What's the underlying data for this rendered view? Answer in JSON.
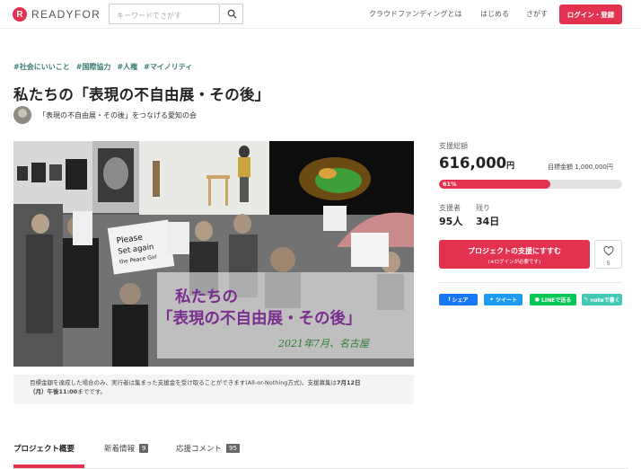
{
  "header": {
    "logo_mark": "R",
    "logo_text": "READYFOR",
    "search_placeholder": "キーワードでさがす",
    "nav": [
      "クラウドファンディングとは",
      "はじめる",
      "さがす"
    ],
    "login_label": "ログイン・登録"
  },
  "project": {
    "tags": [
      "#社会にいいこと",
      "#国際協力",
      "#人権",
      "#マイノリティ"
    ],
    "title": "私たちの「表現の不自由展・その後」",
    "owner_name": "「表現の不自由展・その後」をつなげる愛知の会"
  },
  "hero": {
    "line1": "私たちの",
    "line2": "「表現の不自由展・その後」",
    "line3": "2021年7月、名古屋",
    "sign1": "Please",
    "sign2": "Set again",
    "sign3": "the Peace Girl"
  },
  "notice": {
    "text_before": "目標金額を達成した場合のみ、実行者は集まった支援金を受け取ることができます(All-or-Nothing方式)。支援募集は",
    "deadline_a": "7月12日",
    "deadline_b": "（月）午後11:00",
    "text_after": "までです。"
  },
  "tabs": [
    {
      "label": "プロジェクト概要",
      "badge": ""
    },
    {
      "label": "新着情報",
      "badge": "9"
    },
    {
      "label": "応援コメント",
      "badge": "95"
    }
  ],
  "funding": {
    "total_label": "支援総額",
    "total_amount": "616,000",
    "total_unit": "円",
    "goal_text": "目標金額 1,000,000円",
    "progress_text": "61%",
    "progress_fraction": 0.61,
    "supporters_label": "支援者",
    "supporters_value": "95人",
    "remaining_label": "残り",
    "remaining_value": "34日",
    "support_button_line1": "プロジェクトの支援にすすむ",
    "support_button_line2": "(※ログインが必要です)",
    "favorite_count": "5"
  },
  "share": [
    {
      "label": "シェア",
      "color": "#1877f2"
    },
    {
      "label": "ツイート",
      "color": "#1d9bf0"
    },
    {
      "label": "LINEで送る",
      "color": "#06c755"
    },
    {
      "label": "noteで書く",
      "color": "#41c9b4"
    }
  ],
  "colors": {
    "accent": "#e2324f",
    "tag": "#3a7d74"
  }
}
